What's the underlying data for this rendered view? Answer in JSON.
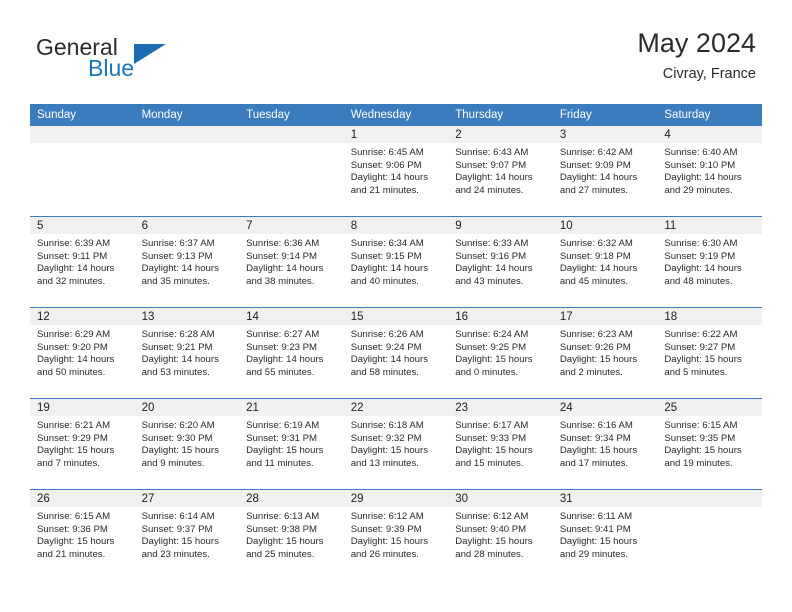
{
  "brand": {
    "name_part1": "General",
    "name_part2": "Blue",
    "flag_icon": "triangle-flag-icon"
  },
  "header": {
    "title": "May 2024",
    "location": "Civray, France"
  },
  "colors": {
    "header_blue": "#3a7cbe",
    "brand_blue": "#1b75bb",
    "daynum_band": "#f0f0f0",
    "text": "#2a2a2a"
  },
  "weekday_headers": [
    "Sunday",
    "Monday",
    "Tuesday",
    "Wednesday",
    "Thursday",
    "Friday",
    "Saturday"
  ],
  "weeks": [
    [
      {
        "day": "",
        "empty": true
      },
      {
        "day": "",
        "empty": true
      },
      {
        "day": "",
        "empty": true
      },
      {
        "day": "1",
        "sunrise": "Sunrise: 6:45 AM",
        "sunset": "Sunset: 9:06 PM",
        "daylight": "Daylight: 14 hours and 21 minutes."
      },
      {
        "day": "2",
        "sunrise": "Sunrise: 6:43 AM",
        "sunset": "Sunset: 9:07 PM",
        "daylight": "Daylight: 14 hours and 24 minutes."
      },
      {
        "day": "3",
        "sunrise": "Sunrise: 6:42 AM",
        "sunset": "Sunset: 9:09 PM",
        "daylight": "Daylight: 14 hours and 27 minutes."
      },
      {
        "day": "4",
        "sunrise": "Sunrise: 6:40 AM",
        "sunset": "Sunset: 9:10 PM",
        "daylight": "Daylight: 14 hours and 29 minutes."
      }
    ],
    [
      {
        "day": "5",
        "sunrise": "Sunrise: 6:39 AM",
        "sunset": "Sunset: 9:11 PM",
        "daylight": "Daylight: 14 hours and 32 minutes."
      },
      {
        "day": "6",
        "sunrise": "Sunrise: 6:37 AM",
        "sunset": "Sunset: 9:13 PM",
        "daylight": "Daylight: 14 hours and 35 minutes."
      },
      {
        "day": "7",
        "sunrise": "Sunrise: 6:36 AM",
        "sunset": "Sunset: 9:14 PM",
        "daylight": "Daylight: 14 hours and 38 minutes."
      },
      {
        "day": "8",
        "sunrise": "Sunrise: 6:34 AM",
        "sunset": "Sunset: 9:15 PM",
        "daylight": "Daylight: 14 hours and 40 minutes."
      },
      {
        "day": "9",
        "sunrise": "Sunrise: 6:33 AM",
        "sunset": "Sunset: 9:16 PM",
        "daylight": "Daylight: 14 hours and 43 minutes."
      },
      {
        "day": "10",
        "sunrise": "Sunrise: 6:32 AM",
        "sunset": "Sunset: 9:18 PM",
        "daylight": "Daylight: 14 hours and 45 minutes."
      },
      {
        "day": "11",
        "sunrise": "Sunrise: 6:30 AM",
        "sunset": "Sunset: 9:19 PM",
        "daylight": "Daylight: 14 hours and 48 minutes."
      }
    ],
    [
      {
        "day": "12",
        "sunrise": "Sunrise: 6:29 AM",
        "sunset": "Sunset: 9:20 PM",
        "daylight": "Daylight: 14 hours and 50 minutes."
      },
      {
        "day": "13",
        "sunrise": "Sunrise: 6:28 AM",
        "sunset": "Sunset: 9:21 PM",
        "daylight": "Daylight: 14 hours and 53 minutes."
      },
      {
        "day": "14",
        "sunrise": "Sunrise: 6:27 AM",
        "sunset": "Sunset: 9:23 PM",
        "daylight": "Daylight: 14 hours and 55 minutes."
      },
      {
        "day": "15",
        "sunrise": "Sunrise: 6:26 AM",
        "sunset": "Sunset: 9:24 PM",
        "daylight": "Daylight: 14 hours and 58 minutes."
      },
      {
        "day": "16",
        "sunrise": "Sunrise: 6:24 AM",
        "sunset": "Sunset: 9:25 PM",
        "daylight": "Daylight: 15 hours and 0 minutes."
      },
      {
        "day": "17",
        "sunrise": "Sunrise: 6:23 AM",
        "sunset": "Sunset: 9:26 PM",
        "daylight": "Daylight: 15 hours and 2 minutes."
      },
      {
        "day": "18",
        "sunrise": "Sunrise: 6:22 AM",
        "sunset": "Sunset: 9:27 PM",
        "daylight": "Daylight: 15 hours and 5 minutes."
      }
    ],
    [
      {
        "day": "19",
        "sunrise": "Sunrise: 6:21 AM",
        "sunset": "Sunset: 9:29 PM",
        "daylight": "Daylight: 15 hours and 7 minutes."
      },
      {
        "day": "20",
        "sunrise": "Sunrise: 6:20 AM",
        "sunset": "Sunset: 9:30 PM",
        "daylight": "Daylight: 15 hours and 9 minutes."
      },
      {
        "day": "21",
        "sunrise": "Sunrise: 6:19 AM",
        "sunset": "Sunset: 9:31 PM",
        "daylight": "Daylight: 15 hours and 11 minutes."
      },
      {
        "day": "22",
        "sunrise": "Sunrise: 6:18 AM",
        "sunset": "Sunset: 9:32 PM",
        "daylight": "Daylight: 15 hours and 13 minutes."
      },
      {
        "day": "23",
        "sunrise": "Sunrise: 6:17 AM",
        "sunset": "Sunset: 9:33 PM",
        "daylight": "Daylight: 15 hours and 15 minutes."
      },
      {
        "day": "24",
        "sunrise": "Sunrise: 6:16 AM",
        "sunset": "Sunset: 9:34 PM",
        "daylight": "Daylight: 15 hours and 17 minutes."
      },
      {
        "day": "25",
        "sunrise": "Sunrise: 6:15 AM",
        "sunset": "Sunset: 9:35 PM",
        "daylight": "Daylight: 15 hours and 19 minutes."
      }
    ],
    [
      {
        "day": "26",
        "sunrise": "Sunrise: 6:15 AM",
        "sunset": "Sunset: 9:36 PM",
        "daylight": "Daylight: 15 hours and 21 minutes."
      },
      {
        "day": "27",
        "sunrise": "Sunrise: 6:14 AM",
        "sunset": "Sunset: 9:37 PM",
        "daylight": "Daylight: 15 hours and 23 minutes."
      },
      {
        "day": "28",
        "sunrise": "Sunrise: 6:13 AM",
        "sunset": "Sunset: 9:38 PM",
        "daylight": "Daylight: 15 hours and 25 minutes."
      },
      {
        "day": "29",
        "sunrise": "Sunrise: 6:12 AM",
        "sunset": "Sunset: 9:39 PM",
        "daylight": "Daylight: 15 hours and 26 minutes."
      },
      {
        "day": "30",
        "sunrise": "Sunrise: 6:12 AM",
        "sunset": "Sunset: 9:40 PM",
        "daylight": "Daylight: 15 hours and 28 minutes."
      },
      {
        "day": "31",
        "sunrise": "Sunrise: 6:11 AM",
        "sunset": "Sunset: 9:41 PM",
        "daylight": "Daylight: 15 hours and 29 minutes."
      },
      {
        "day": "",
        "empty": true
      }
    ]
  ]
}
